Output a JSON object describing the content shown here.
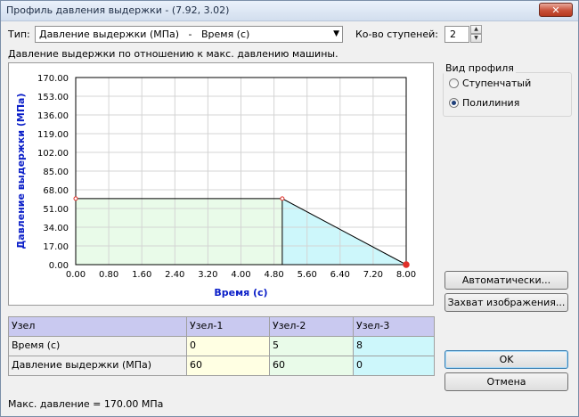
{
  "window": {
    "title": "Профиль давления выдержки - (7.92, 3.02)",
    "close_glyph": "✕"
  },
  "type_label": "Тип:",
  "type_select": {
    "value": "Давление выдержки (МПа)   -   Время (с)"
  },
  "steps_label": "Ко-во ступеней:",
  "steps_value": "2",
  "chart_caption": "Давление выдержки по отношению к макс. давлению машины.",
  "profile_group": {
    "title": "Вид профиля",
    "options": [
      "Ступенчатый",
      "Полилиния"
    ],
    "selected": "Полилиния"
  },
  "buttons": {
    "auto": "Автоматически...",
    "capture": "Захват изображения...",
    "ok": "OK",
    "cancel": "Отмена"
  },
  "table": {
    "header": [
      "Узел",
      "Узел-1",
      "Узел-2",
      "Узел-3"
    ],
    "rows": [
      [
        "Время (с)",
        "0",
        "5",
        "8"
      ],
      [
        "Давление выдержки (МПа)",
        "60",
        "60",
        "0"
      ]
    ]
  },
  "max_pressure_text": "Макс. давление = 170.00 МПа",
  "colors": {
    "accent": "#0a1ec8",
    "node1": "#ffffe3",
    "node2": "#e9fbe9",
    "node3": "#cdf7fb",
    "header": "#c9c9f0",
    "marker": "#e0302a"
  },
  "chart_data": {
    "type": "area",
    "xlabel": "Время (с)",
    "ylabel": "Давление выдержки (МПа)",
    "xlim": [
      0,
      8
    ],
    "ylim": [
      0,
      170
    ],
    "x_ticks": [
      "0.00",
      "0.80",
      "1.60",
      "2.40",
      "3.20",
      "4.00",
      "4.80",
      "5.60",
      "6.40",
      "7.20",
      "8.00"
    ],
    "y_ticks": [
      "0.00",
      "17.00",
      "34.00",
      "51.00",
      "68.00",
      "85.00",
      "102.00",
      "119.00",
      "136.00",
      "153.00",
      "170.00"
    ],
    "grid": true,
    "series": [
      {
        "x": [
          0,
          5,
          8
        ],
        "y": [
          60,
          60,
          0
        ]
      }
    ]
  }
}
